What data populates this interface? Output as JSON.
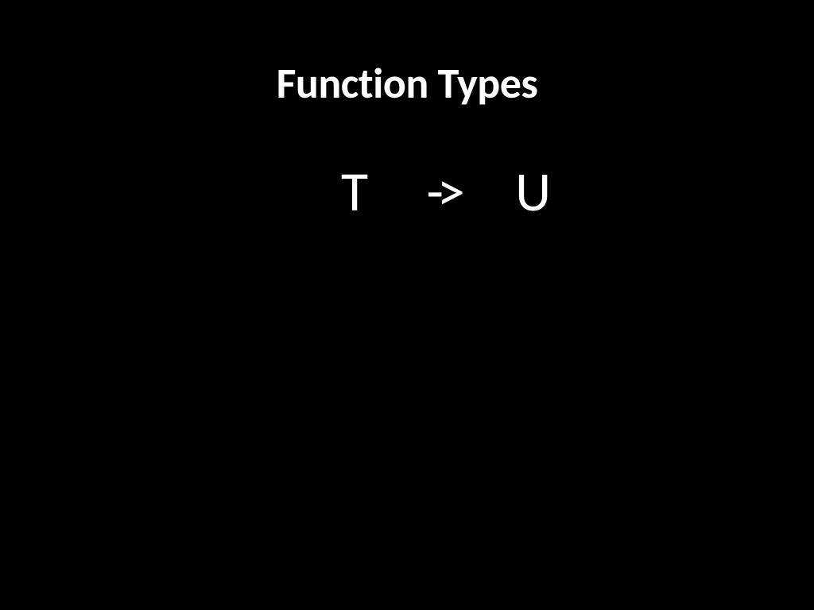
{
  "slide": {
    "title": "Function Types",
    "type_left": "T",
    "arrow": "->",
    "type_right": "U"
  }
}
